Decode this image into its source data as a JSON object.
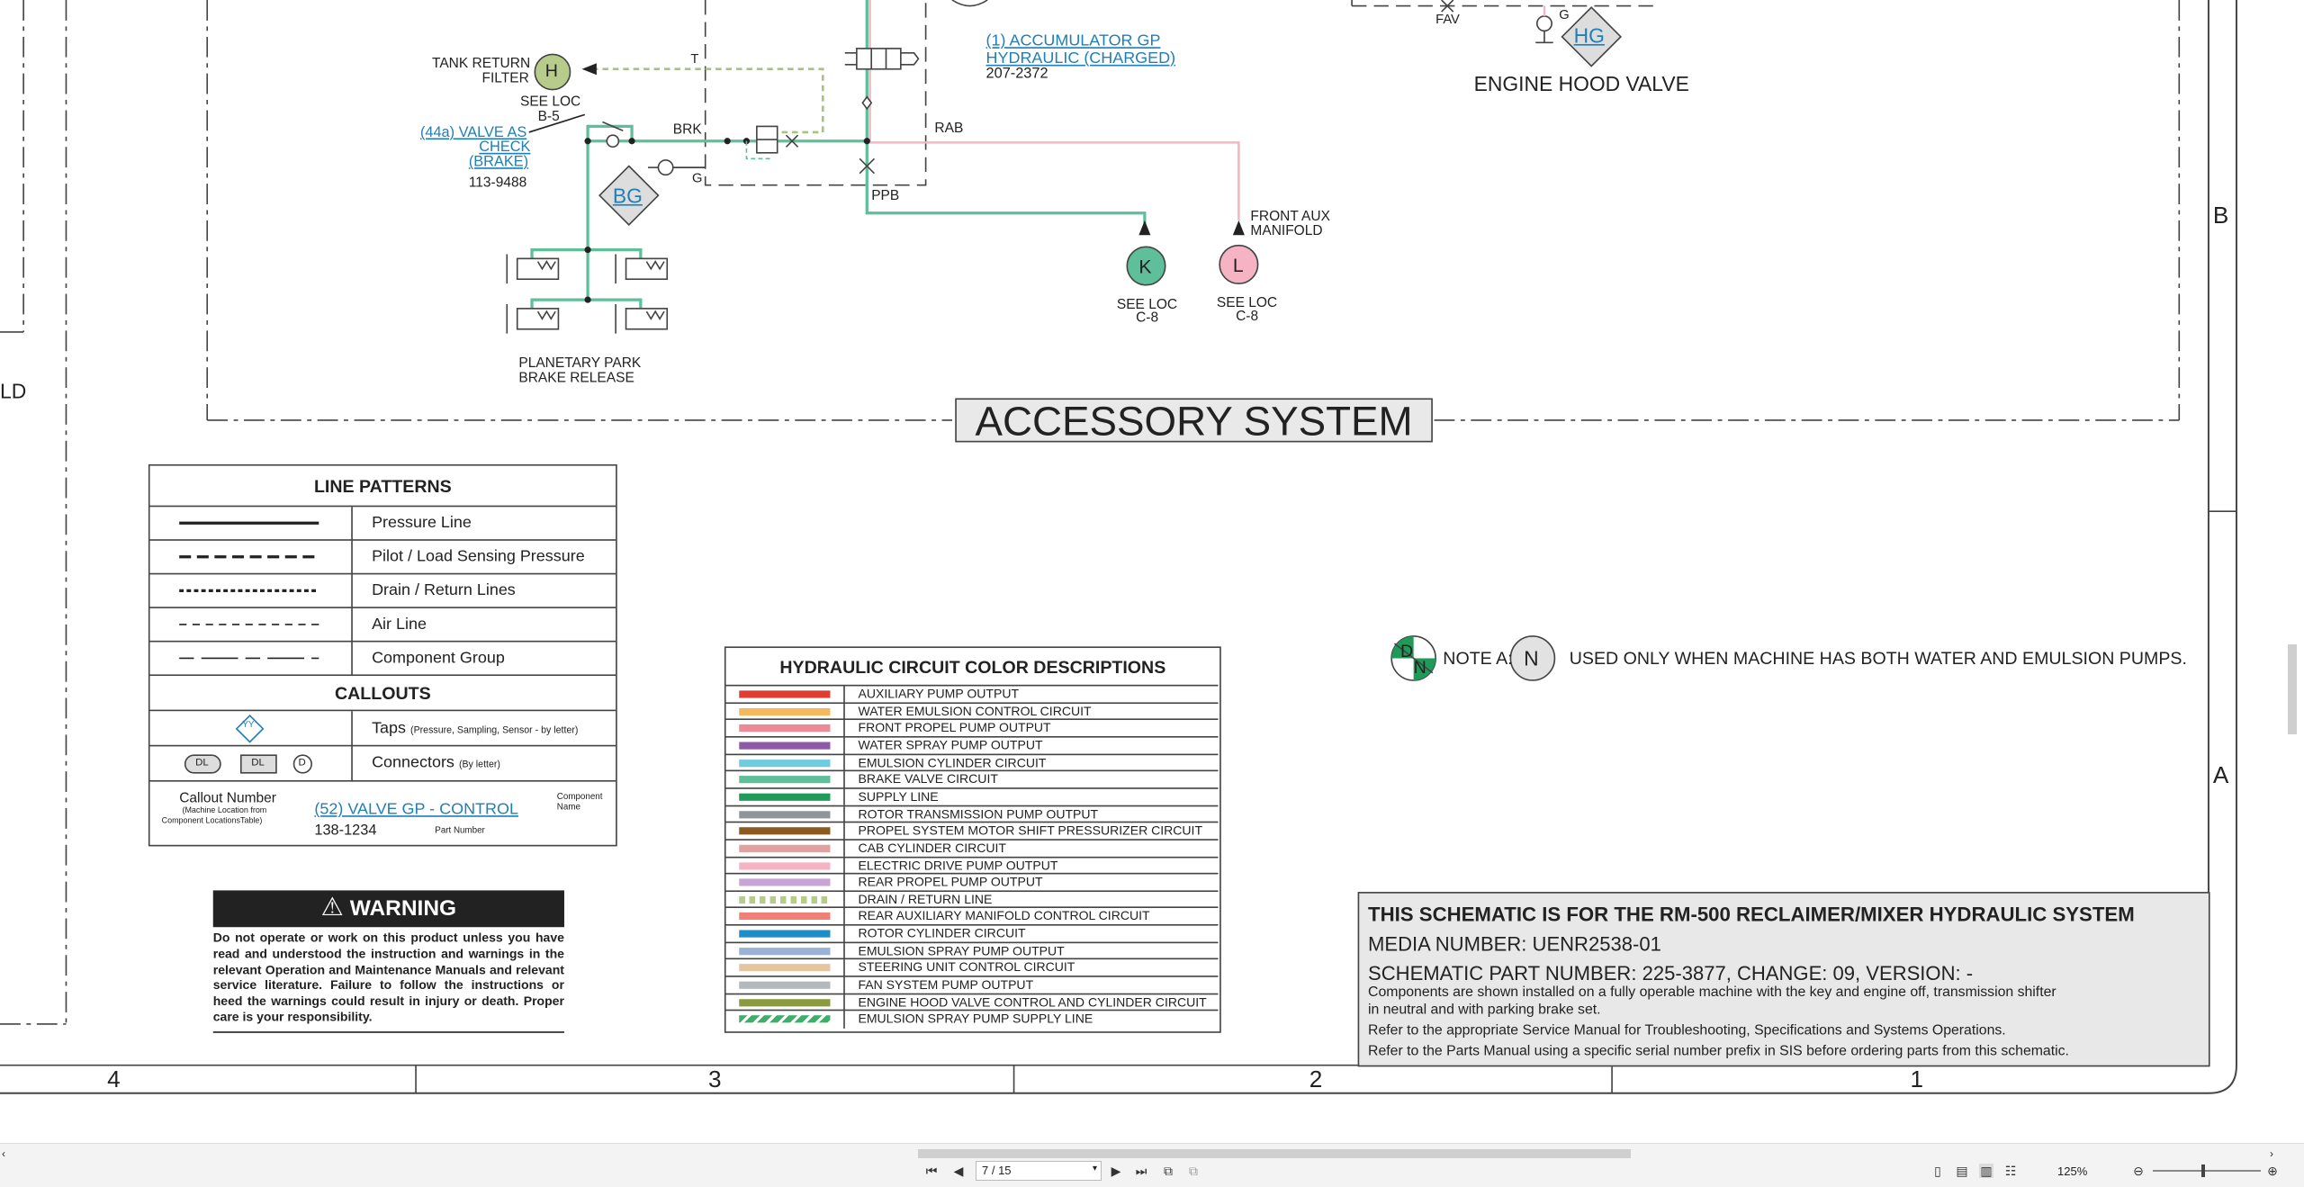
{
  "diagram": {
    "title": "ACCESSORY SYSTEM",
    "hood_valve": "ENGINE HOOD VALVE",
    "fav": "FAV",
    "g_top": "G",
    "hg": "HG",
    "accumulator_link": "(1) ACCUMULATOR GP",
    "accumulator_link2": "HYDRAULIC (CHARGED)",
    "accumulator_part": "207-2372",
    "tank_return": "TANK RETURN",
    "tank_filter": "FILTER",
    "h": "H",
    "see_loc_b5a": "SEE LOC",
    "see_loc_b5b": "B-5",
    "valve_link1": "(44a) VALVE AS",
    "valve_link2": "CHECK",
    "valve_link3": "(BRAKE)",
    "valve_part": "113-9488",
    "brk": "BRK",
    "t": "T",
    "rab": "RAB",
    "ppb": "PPB",
    "g_mid": "G",
    "bg": "BG",
    "k": "K",
    "l": "L",
    "see_loc_k1": "SEE LOC",
    "see_loc_k2": "C-8",
    "see_loc_l1": "SEE LOC",
    "see_loc_l2": "C-8",
    "front_aux1": "FRONT AUX",
    "front_aux2": "MANIFOLD",
    "planetary1": "PLANETARY PARK",
    "planetary2": "BRAKE RELEASE",
    "zone_b": "B",
    "zone_a": "A",
    "ld": "LD",
    "col_4": "4",
    "col_3": "3",
    "col_2": "2",
    "col_1": "1",
    "note_a": "NOTE A:",
    "note_n": "N",
    "note_dn_d": "D",
    "note_dn_n": "N",
    "note_text": "USED ONLY WHEN MACHINE HAS BOTH WATER AND EMULSION PUMPS."
  },
  "line_patterns": {
    "title": "LINE PATTERNS",
    "rows": [
      "Pressure Line",
      "Pilot / Load Sensing Pressure",
      "Drain / Return Lines",
      "Air Line",
      "Component Group"
    ],
    "callouts_title": "CALLOUTS",
    "taps": "Taps",
    "taps_note": "(Pressure, Sampling, Sensor - by letter)",
    "connectors": "Connectors",
    "connectors_note": "(By letter)",
    "tap_yy": "YY",
    "conn_dl1": "DL",
    "conn_dl2": "DL",
    "conn_d": "D",
    "callout_number": "Callout Number",
    "callout_sub1": "(Machine Location from",
    "callout_sub2": "Component LocationsTable)",
    "callout_link": "(52) VALVE GP - CONTROL",
    "component1": "Component",
    "component2": "Name",
    "part": "138-1234",
    "part_number": "Part Number"
  },
  "color_desc": {
    "title": "HYDRAULIC CIRCUIT COLOR DESCRIPTIONS",
    "rows": [
      {
        "label": "AUXILIARY PUMP OUTPUT",
        "color": "#e03c31"
      },
      {
        "label": "WATER EMULSION CONTROL CIRCUIT",
        "color": "#f5b85c"
      },
      {
        "label": "FRONT PROPEL PUMP OUTPUT",
        "color": "#ee8a96"
      },
      {
        "label": "WATER SPRAY PUMP OUTPUT",
        "color": "#8e59a6"
      },
      {
        "label": "EMULSION CYLINDER CIRCUIT",
        "color": "#6ecbe0"
      },
      {
        "label": "BRAKE VALVE CIRCUIT",
        "color": "#5fbf9a"
      },
      {
        "label": "SUPPLY LINE",
        "color": "#1f9a58"
      },
      {
        "label": "ROTOR TRANSMISSION PUMP OUTPUT",
        "color": "#8f9599"
      },
      {
        "label": "PROPEL SYSTEM MOTOR SHIFT PRESSURIZER CIRCUIT",
        "color": "#8b5a1e"
      },
      {
        "label": "CAB CYLINDER CIRCUIT",
        "color": "#e3a0a0"
      },
      {
        "label": "ELECTRIC DRIVE PUMP OUTPUT",
        "color": "#f6b3c3"
      },
      {
        "label": "REAR PROPEL PUMP OUTPUT",
        "color": "#c8a3d6"
      },
      {
        "label": "DRAIN / RETURN LINE",
        "color": "#b7cc8a"
      },
      {
        "label": "REAR AUXILIARY MANIFOLD CONTROL CIRCUIT",
        "color": "#ee8078"
      },
      {
        "label": "ROTOR CYLINDER CIRCUIT",
        "color": "#1f8ec8"
      },
      {
        "label": "EMULSION SPRAY PUMP OUTPUT",
        "color": "#9ab2d6"
      },
      {
        "label": "STEERING UNIT CONTROL CIRCUIT",
        "color": "#e6c49e"
      },
      {
        "label": "FAN SYSTEM PUMP OUTPUT",
        "color": "#b3b8bd"
      },
      {
        "label": "ENGINE HOOD VALVE CONTROL AND CYLINDER CIRCUIT",
        "color": "#8a9a3c"
      },
      {
        "label": "EMULSION SPRAY PUMP SUPPLY LINE",
        "color": "#3fae6a"
      }
    ]
  },
  "warning": {
    "title": "WARNING",
    "text": "Do not operate or work on this product unless you have read and understood the instruction and warnings in the relevant Operation and Maintenance Manuals and relevant service literature. Failure to follow the instructions or heed the warnings could result in injury or death. Proper care is your responsibility."
  },
  "info": {
    "title": "THIS SCHEMATIC IS FOR THE RM-500 RECLAIMER/MIXER HYDRAULIC SYSTEM",
    "media": "MEDIA NUMBER: UENR2538-01",
    "part": "SCHEMATIC PART NUMBER: 225-3877, CHANGE: 09, VERSION: -",
    "line1": "Components are shown installed on a fully operable machine with the key and engine off, transmission shifter",
    "line2": "in neutral and with parking brake set.",
    "line3": "Refer to the appropriate Service Manual for Troubleshooting, Specifications and Systems Operations.",
    "line4": "Refer to the Parts Manual using a specific serial number prefix in SIS before ordering parts from this schematic."
  },
  "toolbar": {
    "page_value": "7 / 15",
    "zoom": "125%"
  }
}
